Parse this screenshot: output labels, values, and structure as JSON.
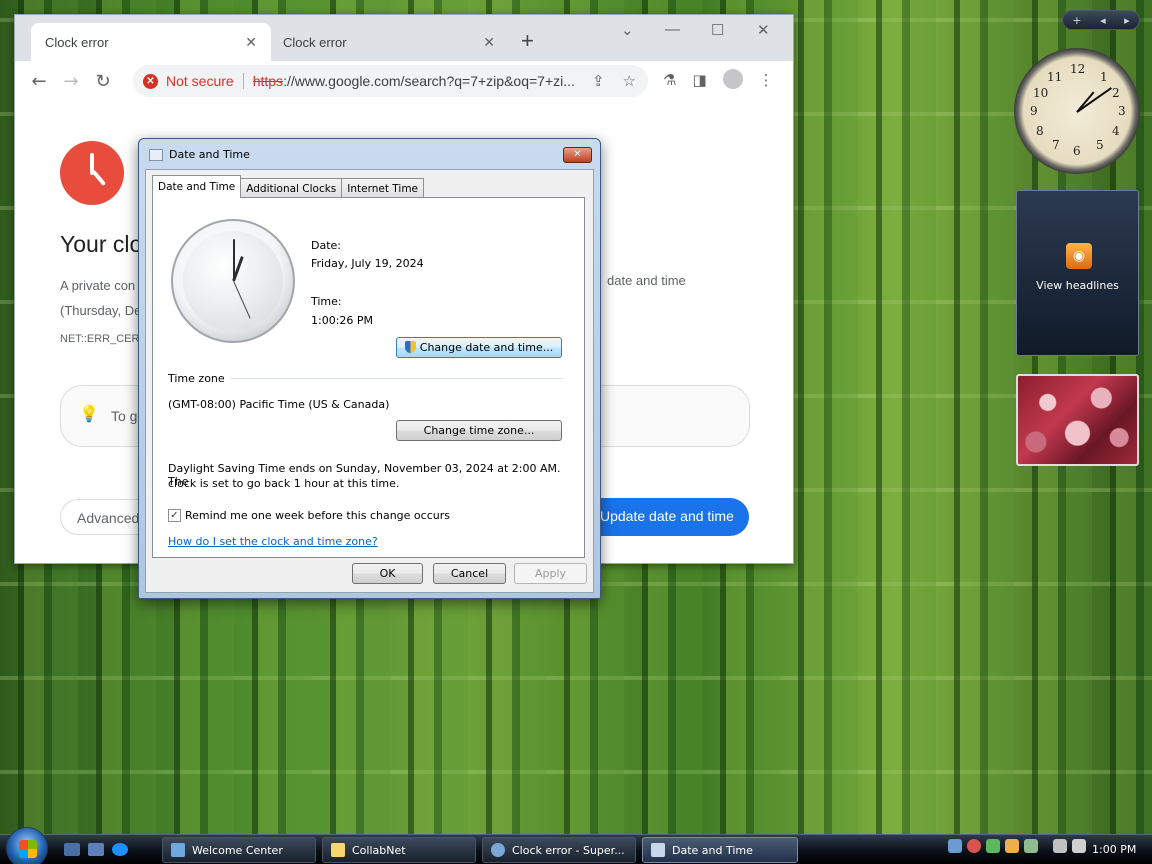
{
  "browser": {
    "tabs": [
      {
        "title": "Clock error"
      },
      {
        "title": "Clock error"
      }
    ],
    "omnibox": {
      "security_label": "Not secure",
      "url_scheme": "https",
      "url_rest": "://www.google.com/search?q=7+zip&oq=7+zi..."
    },
    "page": {
      "heading": "Your clo",
      "body_line1": "A private con",
      "body_line1_right": "date and time",
      "body_line2": "(Thursday, De",
      "error_code": "NET::ERR_CERT",
      "hint_text": "To g",
      "advanced_button": "Advanced",
      "update_button": "Update date and time"
    }
  },
  "dialog": {
    "title": "Date and Time",
    "tabs": [
      "Date and Time",
      "Additional Clocks",
      "Internet Time"
    ],
    "date_label": "Date:",
    "date_value": "Friday, July 19, 2024",
    "time_label": "Time:",
    "time_value": "1:00:26 PM",
    "change_datetime_button": "Change date and time...",
    "timezone_heading": "Time zone",
    "timezone_value": "(GMT-08:00) Pacific Time (US & Canada)",
    "change_timezone_button": "Change time zone...",
    "dst_line1": "Daylight Saving Time ends on Sunday, November 03, 2024 at 2:00 AM. The",
    "dst_line2": "clock is set to go back 1 hour at this time.",
    "remind_checkbox": {
      "label": "Remind me one week before this change occurs",
      "checked": true
    },
    "help_link": "How do I set the clock and time zone?",
    "ok_button": "OK",
    "cancel_button": "Cancel",
    "apply_button": "Apply"
  },
  "gadgets": {
    "clock_numbers": [
      "12",
      "1",
      "2",
      "3",
      "4",
      "5",
      "6",
      "7",
      "8",
      "9",
      "10",
      "11"
    ],
    "feed_label": "View headlines"
  },
  "taskbar": {
    "items": [
      {
        "label": "Welcome Center",
        "active": false
      },
      {
        "label": "CollabNet",
        "active": false
      },
      {
        "label": "Clock error - Super...",
        "active": false
      },
      {
        "label": "Date and Time",
        "active": true
      }
    ],
    "clock": "1:00 PM"
  },
  "colors": {
    "chrome_error_red": "#d93025",
    "chrome_blue": "#1a73e8",
    "vista_link": "#0066cc"
  }
}
